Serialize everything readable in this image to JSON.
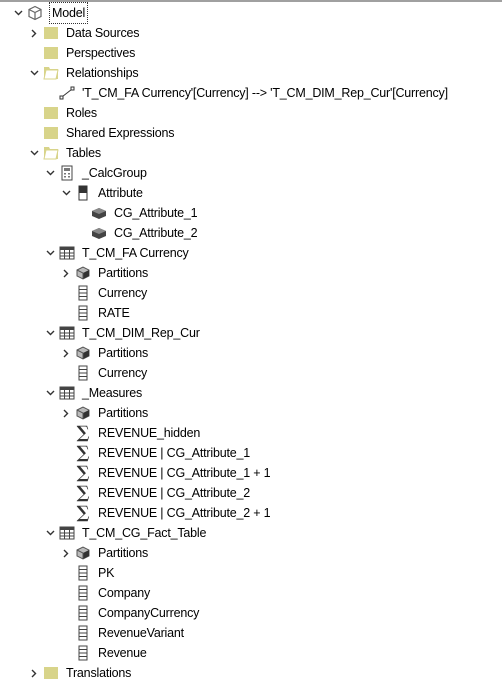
{
  "tree": {
    "root": {
      "label": "Model",
      "icon": "cube-icon",
      "expanded": true,
      "selected": true
    },
    "items": [
      {
        "label": "Data Sources",
        "icon": "folder-icon",
        "level": 1,
        "expander": "collapsed"
      },
      {
        "label": "Perspectives",
        "icon": "folder-icon",
        "level": 1,
        "expander": "none"
      },
      {
        "label": "Relationships",
        "icon": "folder-open-icon",
        "level": 1,
        "expander": "expanded"
      },
      {
        "label": "'T_CM_FA Currency'[Currency] --> 'T_CM_DIM_Rep_Cur'[Currency]",
        "icon": "relationship-icon",
        "level": 2,
        "expander": "none"
      },
      {
        "label": "Roles",
        "icon": "folder-icon",
        "level": 1,
        "expander": "none"
      },
      {
        "label": "Shared Expressions",
        "icon": "folder-icon",
        "level": 1,
        "expander": "none"
      },
      {
        "label": "Tables",
        "icon": "folder-open-icon",
        "level": 1,
        "expander": "expanded"
      },
      {
        "label": "_CalcGroup",
        "icon": "calculator-icon",
        "level": 2,
        "expander": "expanded"
      },
      {
        "label": "Attribute",
        "icon": "calc-column-icon",
        "level": 3,
        "expander": "expanded"
      },
      {
        "label": "CG_Attribute_1",
        "icon": "calc-item-icon",
        "level": 4,
        "expander": "none"
      },
      {
        "label": "CG_Attribute_2",
        "icon": "calc-item-icon",
        "level": 4,
        "expander": "none"
      },
      {
        "label": "T_CM_FA Currency",
        "icon": "table-icon",
        "level": 2,
        "expander": "expanded"
      },
      {
        "label": "Partitions",
        "icon": "partitions-icon",
        "level": 3,
        "expander": "collapsed"
      },
      {
        "label": "Currency",
        "icon": "column-icon",
        "level": 3,
        "expander": "none"
      },
      {
        "label": "RATE",
        "icon": "column-icon",
        "level": 3,
        "expander": "none"
      },
      {
        "label": "T_CM_DIM_Rep_Cur",
        "icon": "table-icon",
        "level": 2,
        "expander": "expanded"
      },
      {
        "label": "Partitions",
        "icon": "partitions-icon",
        "level": 3,
        "expander": "collapsed"
      },
      {
        "label": "Currency",
        "icon": "column-icon",
        "level": 3,
        "expander": "none"
      },
      {
        "label": "_Measures",
        "icon": "table-icon",
        "level": 2,
        "expander": "expanded"
      },
      {
        "label": "Partitions",
        "icon": "partitions-icon",
        "level": 3,
        "expander": "collapsed"
      },
      {
        "label": "REVENUE_hidden",
        "icon": "measure-icon",
        "level": 3,
        "expander": "none"
      },
      {
        "label": "REVENUE | CG_Attribute_1",
        "icon": "measure-icon",
        "level": 3,
        "expander": "none"
      },
      {
        "label": "REVENUE | CG_Attribute_1 + 1",
        "icon": "measure-icon",
        "level": 3,
        "expander": "none"
      },
      {
        "label": "REVENUE | CG_Attribute_2",
        "icon": "measure-icon",
        "level": 3,
        "expander": "none"
      },
      {
        "label": "REVENUE | CG_Attribute_2 + 1",
        "icon": "measure-icon",
        "level": 3,
        "expander": "none"
      },
      {
        "label": "T_CM_CG_Fact_Table",
        "icon": "table-icon",
        "level": 2,
        "expander": "expanded"
      },
      {
        "label": "Partitions",
        "icon": "partitions-icon",
        "level": 3,
        "expander": "collapsed"
      },
      {
        "label": "PK",
        "icon": "column-icon",
        "level": 3,
        "expander": "none"
      },
      {
        "label": "Company",
        "icon": "column-icon",
        "level": 3,
        "expander": "none"
      },
      {
        "label": "CompanyCurrency",
        "icon": "column-icon",
        "level": 3,
        "expander": "none"
      },
      {
        "label": "RevenueVariant",
        "icon": "column-icon",
        "level": 3,
        "expander": "none"
      },
      {
        "label": "Revenue",
        "icon": "column-icon",
        "level": 3,
        "expander": "none"
      },
      {
        "label": "Translations",
        "icon": "folder-icon",
        "level": 1,
        "expander": "collapsed"
      }
    ]
  },
  "colors": {
    "folder": "#d8d48a",
    "icon_gray": "#444444",
    "border": "#a0a0a0"
  }
}
